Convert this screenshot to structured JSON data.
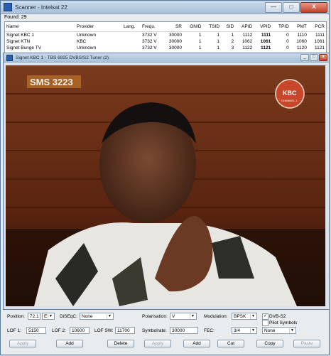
{
  "scanner": {
    "title": "Scanner - Intelsat 22",
    "found_label": "Found: 29",
    "window_buttons": {
      "minimize": "—",
      "maximize": "□",
      "close": "X"
    }
  },
  "table": {
    "headers": [
      "Name",
      "Provider",
      "Lang.",
      "Frequ.",
      "SR",
      "ONID",
      "TSID",
      "SID",
      "APID",
      "VPID",
      "TPID",
      "PMT",
      "PCR"
    ],
    "rows": [
      [
        "Signet KBC 1",
        "Unknown",
        "",
        "3732 V",
        "30000",
        "1",
        "1",
        "1",
        "1112",
        "1111",
        "0",
        "1110",
        "1111"
      ],
      [
        "Signet KTN",
        "KBC",
        "",
        "3732 V",
        "30000",
        "1",
        "1",
        "2",
        "1062",
        "1061",
        "0",
        "1060",
        "1061"
      ],
      [
        "Signet Bunge TV",
        "Unknown",
        "",
        "3732 V",
        "30000",
        "1",
        "1",
        "3",
        "1122",
        "1121",
        "0",
        "1120",
        "1121"
      ]
    ]
  },
  "tv": {
    "title": "Signet KBC 1 - TBS 6925 DVBS/S2 Tuner (2)",
    "overlay_text": "SMS 3223",
    "logo_text": "KBC",
    "logo_sub": "CHANNEL 1"
  },
  "controls": {
    "position_label": "Position:",
    "position_value": "72.1",
    "position_dir": "E",
    "diseqc_label": "DiSEqC:",
    "diseqc_value": "None",
    "lof1_label": "LOF 1:",
    "lof1_value": "5150",
    "lof2_label": "LOF 2:",
    "lof2_value": "10600",
    "lofsw_label": "LOF SW:",
    "lofsw_value": "11700",
    "polarisation_label": "Polarisation:",
    "polarisation_value": "V",
    "modulation_label": "Modulation:",
    "modulation_value": "BPSK",
    "symbolrate_label": "Symbolrate:",
    "symbolrate_value": "30000",
    "fec_label": "FEC:",
    "fec_value": "3/4",
    "dvbs2_label": "DVB-S2",
    "dvbs2_checked": true,
    "pilot_label": "Pilot Symbols",
    "pilot_checked": false,
    "extra_value": "None",
    "buttons": {
      "apply1": "Apply",
      "add1": "Add",
      "delete": "Delete",
      "apply2": "Apply",
      "add2": "Add",
      "cut": "Cut",
      "copy": "Copy",
      "paste": "Paste"
    }
  }
}
